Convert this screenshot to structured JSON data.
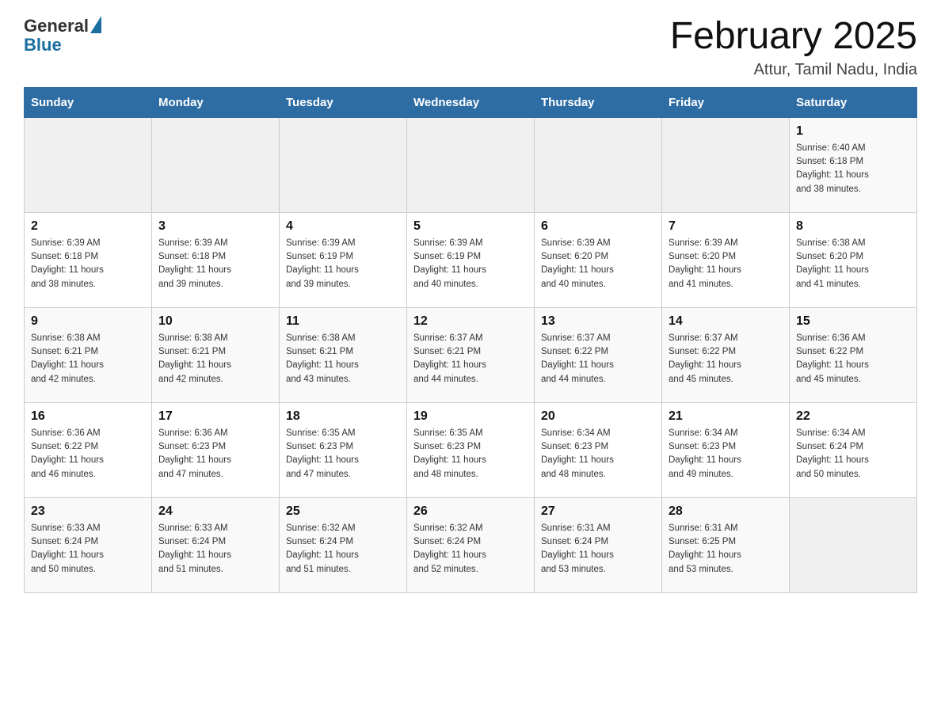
{
  "header": {
    "logo_general": "General",
    "logo_blue": "Blue",
    "month_title": "February 2025",
    "location": "Attur, Tamil Nadu, India"
  },
  "weekdays": [
    "Sunday",
    "Monday",
    "Tuesday",
    "Wednesday",
    "Thursday",
    "Friday",
    "Saturday"
  ],
  "weeks": [
    [
      {
        "day": "",
        "info": ""
      },
      {
        "day": "",
        "info": ""
      },
      {
        "day": "",
        "info": ""
      },
      {
        "day": "",
        "info": ""
      },
      {
        "day": "",
        "info": ""
      },
      {
        "day": "",
        "info": ""
      },
      {
        "day": "1",
        "info": "Sunrise: 6:40 AM\nSunset: 6:18 PM\nDaylight: 11 hours\nand 38 minutes."
      }
    ],
    [
      {
        "day": "2",
        "info": "Sunrise: 6:39 AM\nSunset: 6:18 PM\nDaylight: 11 hours\nand 38 minutes."
      },
      {
        "day": "3",
        "info": "Sunrise: 6:39 AM\nSunset: 6:18 PM\nDaylight: 11 hours\nand 39 minutes."
      },
      {
        "day": "4",
        "info": "Sunrise: 6:39 AM\nSunset: 6:19 PM\nDaylight: 11 hours\nand 39 minutes."
      },
      {
        "day": "5",
        "info": "Sunrise: 6:39 AM\nSunset: 6:19 PM\nDaylight: 11 hours\nand 40 minutes."
      },
      {
        "day": "6",
        "info": "Sunrise: 6:39 AM\nSunset: 6:20 PM\nDaylight: 11 hours\nand 40 minutes."
      },
      {
        "day": "7",
        "info": "Sunrise: 6:39 AM\nSunset: 6:20 PM\nDaylight: 11 hours\nand 41 minutes."
      },
      {
        "day": "8",
        "info": "Sunrise: 6:38 AM\nSunset: 6:20 PM\nDaylight: 11 hours\nand 41 minutes."
      }
    ],
    [
      {
        "day": "9",
        "info": "Sunrise: 6:38 AM\nSunset: 6:21 PM\nDaylight: 11 hours\nand 42 minutes."
      },
      {
        "day": "10",
        "info": "Sunrise: 6:38 AM\nSunset: 6:21 PM\nDaylight: 11 hours\nand 42 minutes."
      },
      {
        "day": "11",
        "info": "Sunrise: 6:38 AM\nSunset: 6:21 PM\nDaylight: 11 hours\nand 43 minutes."
      },
      {
        "day": "12",
        "info": "Sunrise: 6:37 AM\nSunset: 6:21 PM\nDaylight: 11 hours\nand 44 minutes."
      },
      {
        "day": "13",
        "info": "Sunrise: 6:37 AM\nSunset: 6:22 PM\nDaylight: 11 hours\nand 44 minutes."
      },
      {
        "day": "14",
        "info": "Sunrise: 6:37 AM\nSunset: 6:22 PM\nDaylight: 11 hours\nand 45 minutes."
      },
      {
        "day": "15",
        "info": "Sunrise: 6:36 AM\nSunset: 6:22 PM\nDaylight: 11 hours\nand 45 minutes."
      }
    ],
    [
      {
        "day": "16",
        "info": "Sunrise: 6:36 AM\nSunset: 6:22 PM\nDaylight: 11 hours\nand 46 minutes."
      },
      {
        "day": "17",
        "info": "Sunrise: 6:36 AM\nSunset: 6:23 PM\nDaylight: 11 hours\nand 47 minutes."
      },
      {
        "day": "18",
        "info": "Sunrise: 6:35 AM\nSunset: 6:23 PM\nDaylight: 11 hours\nand 47 minutes."
      },
      {
        "day": "19",
        "info": "Sunrise: 6:35 AM\nSunset: 6:23 PM\nDaylight: 11 hours\nand 48 minutes."
      },
      {
        "day": "20",
        "info": "Sunrise: 6:34 AM\nSunset: 6:23 PM\nDaylight: 11 hours\nand 48 minutes."
      },
      {
        "day": "21",
        "info": "Sunrise: 6:34 AM\nSunset: 6:23 PM\nDaylight: 11 hours\nand 49 minutes."
      },
      {
        "day": "22",
        "info": "Sunrise: 6:34 AM\nSunset: 6:24 PM\nDaylight: 11 hours\nand 50 minutes."
      }
    ],
    [
      {
        "day": "23",
        "info": "Sunrise: 6:33 AM\nSunset: 6:24 PM\nDaylight: 11 hours\nand 50 minutes."
      },
      {
        "day": "24",
        "info": "Sunrise: 6:33 AM\nSunset: 6:24 PM\nDaylight: 11 hours\nand 51 minutes."
      },
      {
        "day": "25",
        "info": "Sunrise: 6:32 AM\nSunset: 6:24 PM\nDaylight: 11 hours\nand 51 minutes."
      },
      {
        "day": "26",
        "info": "Sunrise: 6:32 AM\nSunset: 6:24 PM\nDaylight: 11 hours\nand 52 minutes."
      },
      {
        "day": "27",
        "info": "Sunrise: 6:31 AM\nSunset: 6:24 PM\nDaylight: 11 hours\nand 53 minutes."
      },
      {
        "day": "28",
        "info": "Sunrise: 6:31 AM\nSunset: 6:25 PM\nDaylight: 11 hours\nand 53 minutes."
      },
      {
        "day": "",
        "info": ""
      }
    ]
  ]
}
